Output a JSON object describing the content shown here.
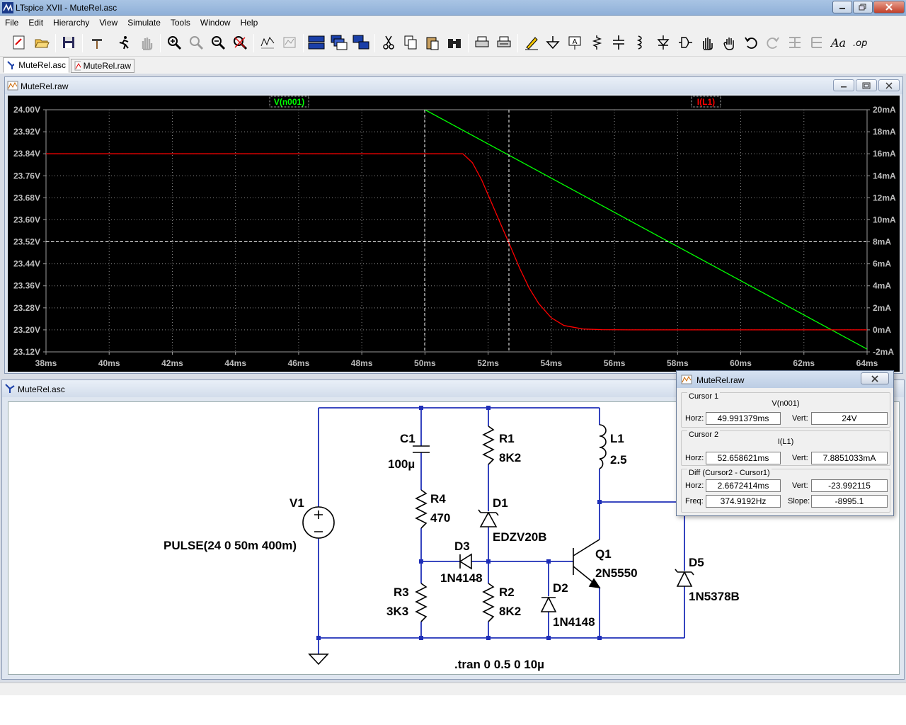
{
  "window": {
    "title": "LTspice XVII - MuteRel.asc"
  },
  "menu": [
    "File",
    "Edit",
    "Hierarchy",
    "View",
    "Simulate",
    "Tools",
    "Window",
    "Help"
  ],
  "tabs": [
    {
      "label": "MuteRel.asc",
      "active": true
    },
    {
      "label": "MuteRel.raw",
      "active": false
    }
  ],
  "waveform_window": {
    "title": "MuteRel.raw"
  },
  "schematic_window": {
    "title": "MuteRel.asc"
  },
  "chart_data": {
    "type": "line",
    "series": [
      {
        "name": "V(n001)",
        "color": "#00ff00",
        "axis": "left",
        "x": [
          50.0,
          64.0
        ],
        "y": [
          24.0,
          23.13
        ]
      },
      {
        "name": "I(L1)",
        "color": "#ff0000",
        "axis": "right",
        "x": [
          38.0,
          51.2,
          51.5,
          51.8,
          52.1,
          52.4,
          52.66,
          53.0,
          53.3,
          53.6,
          54.0,
          54.4,
          55.0,
          55.6,
          56.5,
          64.0
        ],
        "y": [
          16.0,
          16.0,
          15.2,
          13.6,
          11.6,
          9.6,
          7.885,
          5.6,
          3.8,
          2.4,
          1.1,
          0.4,
          0.08,
          0.02,
          0.0,
          0.0
        ]
      }
    ],
    "x_ticks": [
      "38ms",
      "40ms",
      "42ms",
      "44ms",
      "46ms",
      "48ms",
      "50ms",
      "52ms",
      "54ms",
      "56ms",
      "58ms",
      "60ms",
      "62ms",
      "64ms"
    ],
    "x_tick_values": [
      38,
      40,
      42,
      44,
      46,
      48,
      50,
      52,
      54,
      56,
      58,
      60,
      62,
      64
    ],
    "y_left_ticks": [
      "24.00V",
      "23.92V",
      "23.84V",
      "23.76V",
      "23.68V",
      "23.60V",
      "23.52V",
      "23.44V",
      "23.36V",
      "23.28V",
      "23.20V",
      "23.12V"
    ],
    "y_right_ticks": [
      "20mA",
      "18mA",
      "16mA",
      "14mA",
      "12mA",
      "10mA",
      "8mA",
      "6mA",
      "4mA",
      "2mA",
      "0mA",
      "-2mA"
    ],
    "xlim": [
      38,
      64
    ],
    "ylim_left": [
      23.12,
      24.0
    ],
    "ylim_right": [
      -2,
      20
    ],
    "grid": true,
    "cursor1_x": 49.991379,
    "cursor2_x": 52.658621,
    "cursor2_yleft": 23.52
  },
  "cursor_dialog": {
    "title": "MuteRel.raw",
    "cursor1": {
      "label": "Cursor 1",
      "trace": "V(n001)",
      "horz_label": "Horz:",
      "horz": "49.991379ms",
      "vert_label": "Vert:",
      "vert": "24V"
    },
    "cursor2": {
      "label": "Cursor 2",
      "trace": "I(L1)",
      "horz_label": "Horz:",
      "horz": "52.658621ms",
      "vert_label": "Vert:",
      "vert": "7.8851033mA"
    },
    "diff": {
      "label": "Diff (Cursor2 - Cursor1)",
      "horz_label": "Horz:",
      "horz": "2.6672414ms",
      "vert_label": "Vert:",
      "vert": "-23.992115",
      "freq_label": "Freq:",
      "freq": "374.9192Hz",
      "slope_label": "Slope:",
      "slope": "-8995.1"
    }
  },
  "schematic": {
    "V1": {
      "name": "V1",
      "value": "PULSE(24 0 50m 400m)"
    },
    "C1": {
      "name": "C1",
      "value": "100µ"
    },
    "R1": {
      "name": "R1",
      "value": "8K2"
    },
    "L1": {
      "name": "L1",
      "value": "2.5"
    },
    "R4": {
      "name": "R4",
      "value": "470"
    },
    "D1": {
      "name": "D1",
      "value": "EDZV20B"
    },
    "D3": {
      "name": "D3",
      "value": "1N4148"
    },
    "Q1": {
      "name": "Q1",
      "value": "2N5550"
    },
    "R3": {
      "name": "R3",
      "value": "3K3"
    },
    "R2": {
      "name": "R2",
      "value": "8K2"
    },
    "D2": {
      "name": "D2",
      "value": "1N4148"
    },
    "D5": {
      "name": "D5",
      "value": "1N5378B"
    },
    "directive": ".tran 0 0.5 0 10µ"
  }
}
